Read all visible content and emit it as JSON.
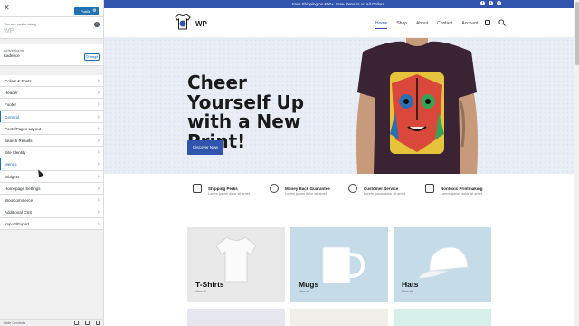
{
  "customizer": {
    "publish_label": "Publish",
    "customizing_label": "You are customizing",
    "site_title": "WP",
    "active_theme_label": "Active theme",
    "theme_name": "Kadence",
    "change_label": "Change",
    "sections": [
      {
        "label": "Colors & Fonts",
        "style": "normal"
      },
      {
        "label": "Header",
        "style": "normal"
      },
      {
        "label": "Footer",
        "style": "normal"
      },
      {
        "label": "General",
        "style": "blue"
      },
      {
        "label": "Posts/Pages Layout",
        "style": "normal"
      },
      {
        "label": "Search Results",
        "style": "normal"
      },
      {
        "label": "Site Identity",
        "style": "normal"
      },
      {
        "label": "Menus",
        "style": "blue"
      },
      {
        "label": "Widgets",
        "style": "normal"
      },
      {
        "label": "Homepage Settings",
        "style": "normal"
      },
      {
        "label": "WooCommerce",
        "style": "normal"
      },
      {
        "label": "Additional CSS",
        "style": "normal"
      },
      {
        "label": "Import/Export",
        "style": "normal"
      }
    ],
    "hide_controls_label": "Hide Controls"
  },
  "site": {
    "promo": "Free Shipping on €90+. Free Returns on All Orders.",
    "logo_text": "WP",
    "nav": [
      "Home",
      "Shop",
      "About",
      "Contact",
      "Account"
    ],
    "hero_title": "Cheer Yourself Up with a New Print!",
    "cta": "Discover Now",
    "perks": [
      {
        "title": "Shipping Perks",
        "desc": "Lorem ipsum dolor sit amet."
      },
      {
        "title": "Money Back Guarantee",
        "desc": "Lorem ipsum dolor sit amet."
      },
      {
        "title": "Customer Service",
        "desc": "Lorem ipsum dolor sit amet."
      },
      {
        "title": "Nontoxic Printmaking",
        "desc": "Lorem ipsum dolor sit amet."
      }
    ],
    "categories": [
      {
        "title": "T-Shirts",
        "link": "View all",
        "color": "#e9e9e9"
      },
      {
        "title": "Mugs",
        "link": "View all",
        "color": "#c6dbe8"
      },
      {
        "title": "Hats",
        "link": "View all",
        "color": "#c6dbe8"
      }
    ],
    "colors": {
      "brand": "#3154ad"
    }
  }
}
